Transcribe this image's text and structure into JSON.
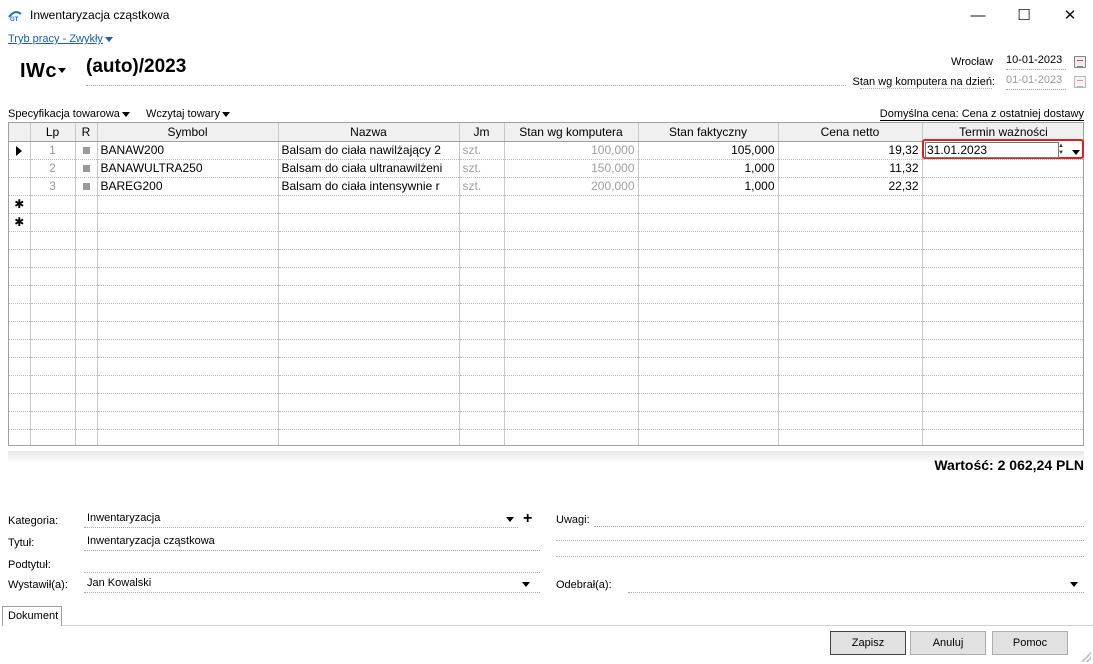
{
  "window": {
    "title": "Inwentaryzacja cząstkowa",
    "minimize": "—",
    "maximize": "☐",
    "close": "✕"
  },
  "mode_link": "Tryb pracy - Zwykły",
  "header": {
    "doc_type": "IWc",
    "doc_number": "(auto)/2023",
    "place": "Wrocław",
    "date": "10-01-2023",
    "stan_label": "Stan wg komputera na dzień:",
    "stan_date": "01-01-2023"
  },
  "toolbar": {
    "spec": "Specyfikacja towarowa",
    "load": "Wczytaj towary",
    "default_price": "Domyślna cena: Cena z ostatniej dostawy"
  },
  "grid": {
    "columns": [
      "",
      "Lp",
      "R",
      "Symbol",
      "Nazwa",
      "Jm",
      "Stan wg komputera",
      "Stan faktyczny",
      "Cena netto",
      "Termin ważności"
    ],
    "rows": [
      {
        "lp": "1",
        "symbol": "BANAW200",
        "nazwa": "Balsam do ciała nawilżający 2",
        "jm": "szt.",
        "stan_komp": "100,000",
        "stan_fakt": "105,000",
        "cena": "19,32",
        "termin": "31.01.2023"
      },
      {
        "lp": "2",
        "symbol": "BANAWULTRA250",
        "nazwa": "Balsam do ciała ultranawilżeni",
        "jm": "szt.",
        "stan_komp": "150,000",
        "stan_fakt": "1,000",
        "cena": "11,32",
        "termin": ""
      },
      {
        "lp": "3",
        "symbol": "BAREG200",
        "nazwa": "Balsam do ciała intensywnie r",
        "jm": "szt.",
        "stan_komp": "200,000",
        "stan_fakt": "1,000",
        "cena": "22,32",
        "termin": ""
      }
    ],
    "new_row_marker": "✱",
    "current_row_marker": "▶"
  },
  "summary": {
    "wartosc": "Wartość: 2 062,24 PLN"
  },
  "form": {
    "kategoria_label": "Kategoria:",
    "kategoria_value": "Inwentaryzacja",
    "tytul_label": "Tytuł:",
    "tytul_value": "Inwentaryzacja cząstkowa",
    "podtytul_label": "Podtytuł:",
    "podtytul_value": "",
    "wystawil_label": "Wystawił(a):",
    "wystawil_value": "Jan Kowalski",
    "uwagi_label": "Uwagi:",
    "odebral_label": "Odebrał(a):",
    "odebral_value": ""
  },
  "tabs": {
    "dokument": "Dokument"
  },
  "buttons": {
    "save": "Zapisz",
    "cancel": "Anuluj",
    "help": "Pomoc"
  },
  "colors": {
    "link": "#1a5fb4",
    "highlight": "#e02020"
  }
}
